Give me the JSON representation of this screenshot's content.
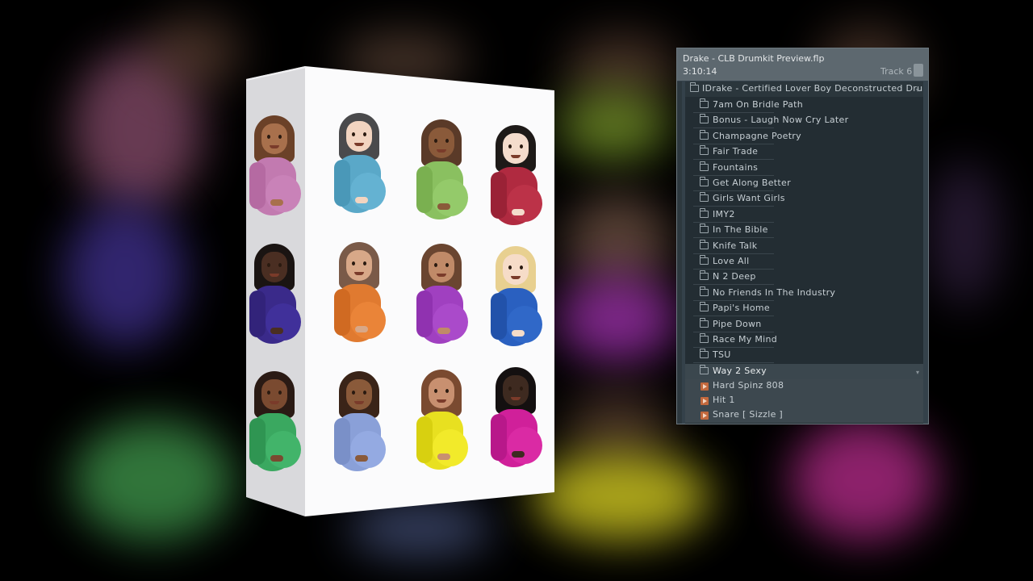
{
  "panel": {
    "title": "Drake - CLB Drumkit Preview.flp",
    "time": "3:10:14",
    "track": "Track 6"
  },
  "browser": {
    "root": "IDrake - Certified Lover Boy Deconstructed Drum Kit",
    "folders": [
      "7am On Bridle Path",
      "Bonus - Laugh Now Cry Later",
      "Champagne Poetry",
      "Fair Trade",
      "Fountains",
      "Get Along Better",
      "Girls Want Girls",
      "IMY2",
      "In The Bible",
      "Knife Talk",
      "Love All",
      "N 2 Deep",
      "No Friends In The Industry",
      "Papi's Home",
      "Pipe Down",
      "Race My Mind",
      "TSU"
    ],
    "selected_folder": "Way 2 Sexy",
    "files": [
      "Hard Spinz 808",
      "Hit 1",
      "Snare [ Sizzle ]"
    ]
  },
  "icons": {
    "folder": "folder-icon",
    "audio": "audio-file-icon",
    "plugin": "plugin-icon"
  },
  "colors": {
    "panel_bg": "#34414a",
    "panel_header": "#5d686f",
    "list_bg": "#232d33",
    "text": "#c6ced3",
    "audio_icon": "#c2683d"
  }
}
